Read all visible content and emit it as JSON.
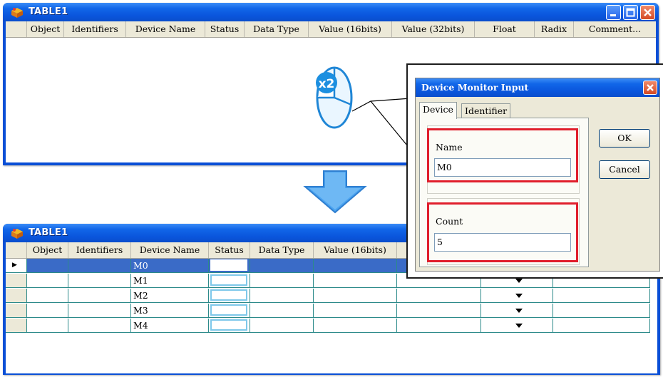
{
  "top_window": {
    "title": "TABLE1",
    "columns": [
      "Object",
      "Identifiers",
      "Device Name",
      "Status",
      "Data Type",
      "Value (16bits)",
      "Value (32bits)",
      "Float",
      "Radix",
      "Comment..."
    ]
  },
  "bottom_window": {
    "title": "TABLE1",
    "columns": [
      "Object",
      "Identifiers",
      "Device Name",
      "Status",
      "Data Type",
      "Value (16bits)"
    ],
    "rows": [
      {
        "device": "M0",
        "selected": true
      },
      {
        "device": "M1",
        "selected": false
      },
      {
        "device": "M2",
        "selected": false
      },
      {
        "device": "M3",
        "selected": false
      },
      {
        "device": "M4",
        "selected": false
      }
    ]
  },
  "dialog": {
    "title": "Device Monitor Input",
    "tabs": [
      "Device",
      "Identifier"
    ],
    "active_tab": "Device",
    "name_label": "Name",
    "name_value": "M0",
    "count_label": "Count",
    "count_value": "5",
    "ok_label": "OK",
    "cancel_label": "Cancel"
  },
  "mouse_badge": "x2",
  "colors": {
    "titlebar": "#0a55dc",
    "selection": "#3a6bc7",
    "highlight_box": "#e01e2c",
    "arrow": "#4aa3f0"
  }
}
